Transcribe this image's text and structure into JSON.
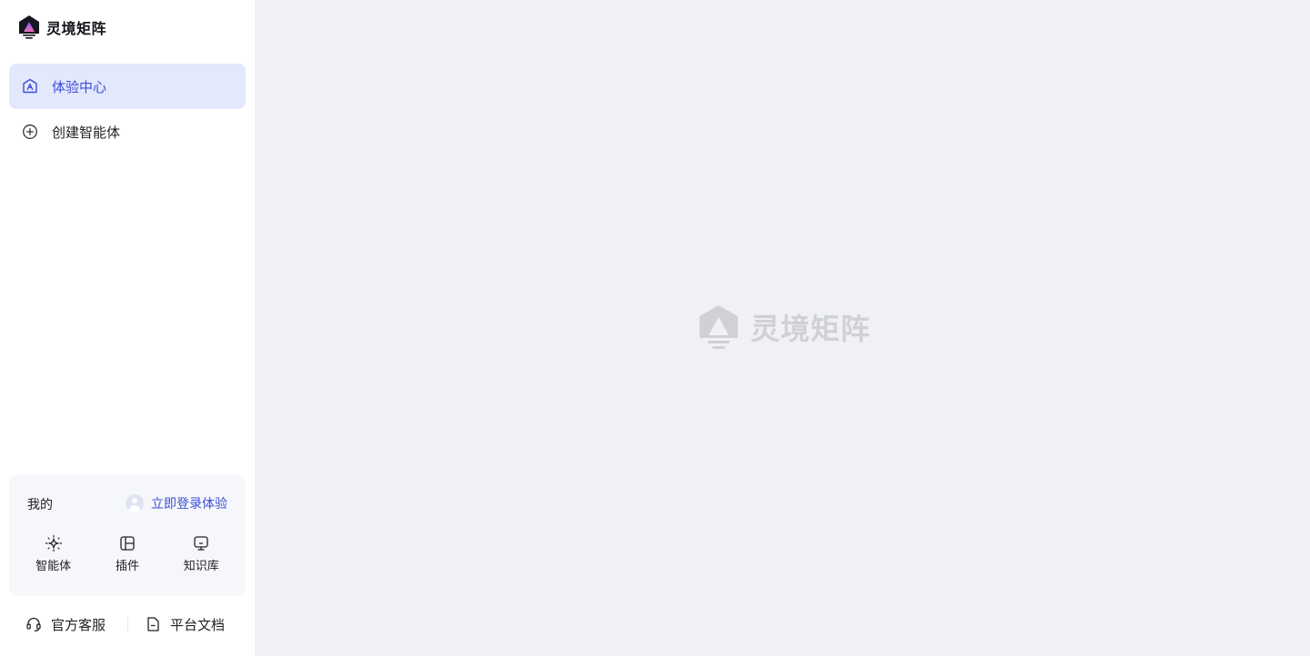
{
  "brand": {
    "name": "灵境矩阵",
    "logo_icon": "brand-logo-icon"
  },
  "nav": {
    "items": [
      {
        "label": "体验中心",
        "icon": "experience-center-icon",
        "active": true
      },
      {
        "label": "创建智能体",
        "icon": "plus-circle-icon",
        "active": false
      }
    ]
  },
  "my": {
    "title": "我的",
    "login_label": "立即登录体验",
    "quick": [
      {
        "label": "智能体",
        "icon": "sparkle-icon"
      },
      {
        "label": "插件",
        "icon": "plugin-icon"
      },
      {
        "label": "知识库",
        "icon": "knowledge-base-icon"
      }
    ]
  },
  "footer": {
    "support_label": "官方客服",
    "docs_label": "平台文档"
  },
  "main": {
    "watermark_text": "灵境矩阵"
  },
  "colors": {
    "accent": "#3b4fd8",
    "active_bg": "#e4e8fc",
    "main_bg": "#f0f1f5",
    "watermark": "#cfd1d6"
  }
}
